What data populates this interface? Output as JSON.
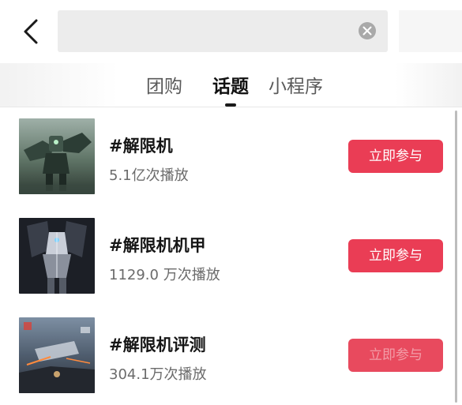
{
  "header": {
    "back_icon": "chevron-left-icon",
    "search_value": "",
    "clear_icon": "close-circle-icon"
  },
  "tabs": [
    {
      "label": "团购",
      "active": false
    },
    {
      "label": "话题",
      "active": true
    },
    {
      "label": "小程序",
      "active": false
    }
  ],
  "topics": [
    {
      "title": "#解限机",
      "plays": "5.1亿次播放",
      "action": "立即参与",
      "thumb": "mech-artwork-1"
    },
    {
      "title": "#解限机机甲",
      "plays": "1129.0 万次播放",
      "action": "立即参与",
      "thumb": "mech-artwork-2"
    },
    {
      "title": "#解限机评测",
      "plays": "304.1万次播放",
      "action": "立即参与",
      "thumb": "mech-battle-scene"
    }
  ],
  "colors": {
    "accent": "#ea3d55",
    "search_bg": "#ececec",
    "title_text": "#161616",
    "subtitle_text": "#6b6b6b"
  }
}
